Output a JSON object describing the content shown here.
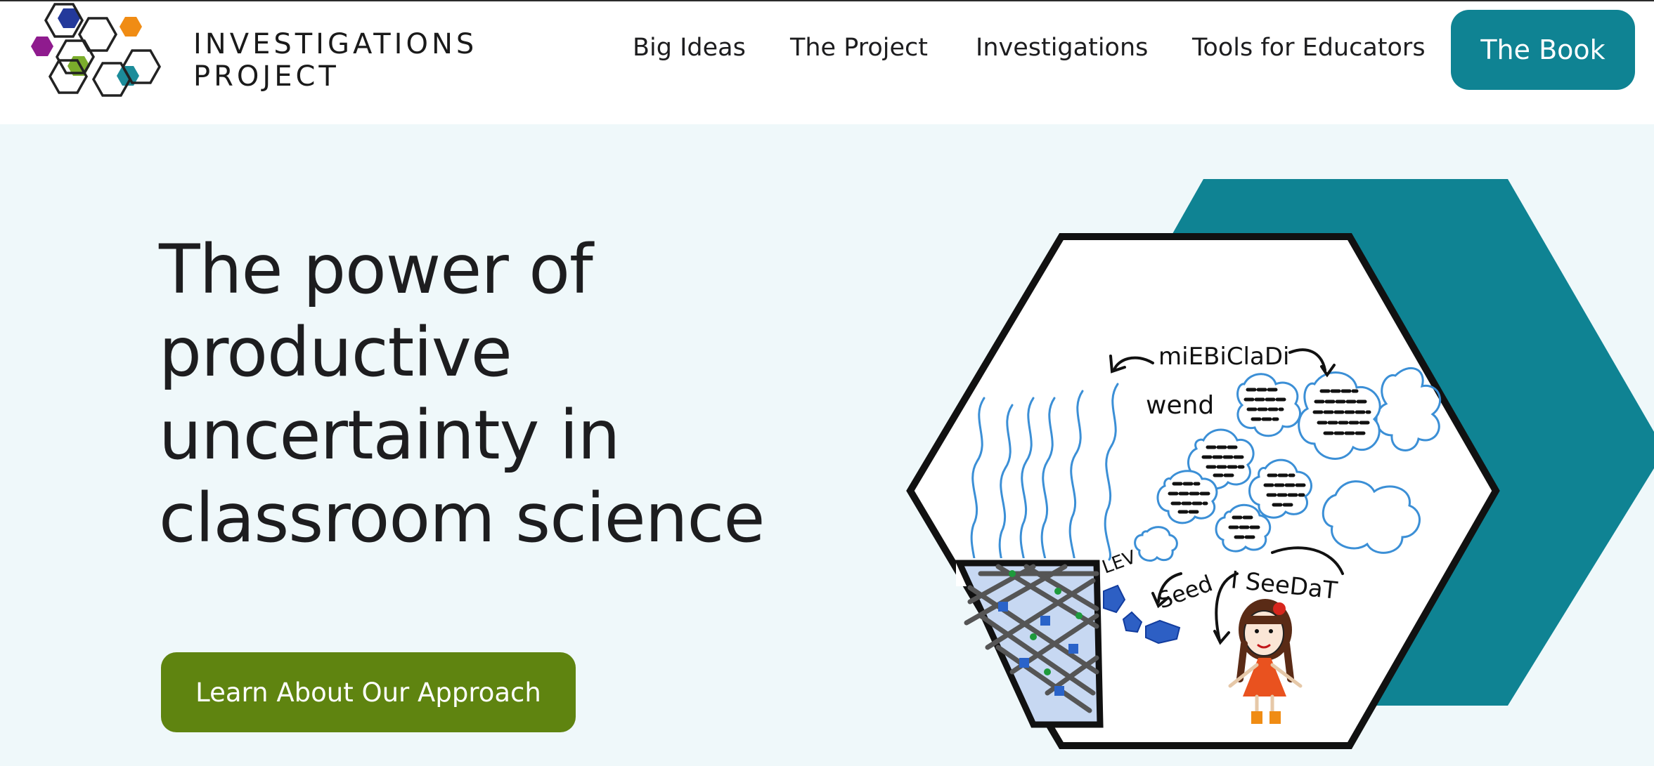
{
  "brand": {
    "name_line1": "INVESTIGATIONS",
    "name_line2": "PROJECT",
    "colors": [
      "#8f1b8e",
      "#23399b",
      "#f08c14",
      "#7bad2b",
      "#1c8c9a",
      "#222222"
    ]
  },
  "nav": {
    "items": [
      {
        "label": "Big Ideas"
      },
      {
        "label": "The Project"
      },
      {
        "label": "Investigations"
      },
      {
        "label": "Tools for Educators"
      }
    ],
    "cta_label": "The Book"
  },
  "hero": {
    "headline_lines": [
      "The power of",
      "productive",
      "uncertainty in",
      "classroom science"
    ],
    "cta_label": "Learn About Our Approach",
    "drawing_labels": {
      "top": "miEBiClaDi",
      "wind": "wend",
      "lev": "LEV",
      "seed": "Seed",
      "speech": "I SeeDaT"
    }
  },
  "colors": {
    "teal": "#0f8393",
    "green_button": "#5f8410",
    "hero_bg": "#eff8fa"
  }
}
